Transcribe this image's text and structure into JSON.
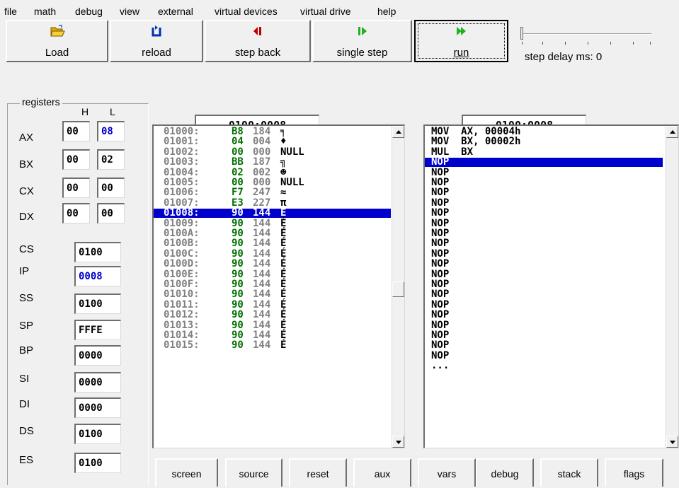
{
  "menu": [
    "file",
    "math",
    "debug",
    "view",
    "external",
    "virtual devices",
    "virtual drive",
    "help"
  ],
  "toolbar": {
    "load": "Load",
    "reload": "reload",
    "step_back": "step back",
    "single_step": "single step",
    "run": "run",
    "step_delay": "step delay ms: 0",
    "step_delay_slider_position": 0,
    "colors": {
      "load": "#e0a800",
      "reload": "#0030b0",
      "step_back": "#c00000",
      "single_step": "#20b020",
      "run": "#20b020"
    }
  },
  "registers": {
    "title": "registers",
    "col_h": "H",
    "col_l": "L",
    "split": [
      {
        "name": "AX",
        "h": "00",
        "l": "08",
        "l_changed": true
      },
      {
        "name": "BX",
        "h": "00",
        "l": "02"
      },
      {
        "name": "CX",
        "h": "00",
        "l": "00"
      },
      {
        "name": "DX",
        "h": "00",
        "l": "00"
      }
    ],
    "full": [
      {
        "name": "CS",
        "value": "0100"
      },
      {
        "name": "IP",
        "value": "0008",
        "changed": true
      },
      {
        "name": "SS",
        "value": "0100"
      },
      {
        "name": "SP",
        "value": "FFFE"
      },
      {
        "name": "BP",
        "value": "0000"
      },
      {
        "name": "SI",
        "value": "0000"
      },
      {
        "name": "DI",
        "value": "0000"
      },
      {
        "name": "DS",
        "value": "0100"
      },
      {
        "name": "ES",
        "value": "0100"
      }
    ]
  },
  "memory": {
    "address": "0100:0008",
    "rows": [
      {
        "addr": "01000:",
        "hex": "B8",
        "dec": "184",
        "chr": "╕"
      },
      {
        "addr": "01001:",
        "hex": "04",
        "dec": "004",
        "chr": "♦"
      },
      {
        "addr": "01002:",
        "hex": "00",
        "dec": "000",
        "chr": "NULL"
      },
      {
        "addr": "01003:",
        "hex": "BB",
        "dec": "187",
        "chr": "╗"
      },
      {
        "addr": "01004:",
        "hex": "02",
        "dec": "002",
        "chr": "☻"
      },
      {
        "addr": "01005:",
        "hex": "00",
        "dec": "000",
        "chr": "NULL"
      },
      {
        "addr": "01006:",
        "hex": "F7",
        "dec": "247",
        "chr": "≈"
      },
      {
        "addr": "01007:",
        "hex": "E3",
        "dec": "227",
        "chr": "π"
      },
      {
        "addr": "01008:",
        "hex": "90",
        "dec": "144",
        "chr": "É",
        "selected": true
      },
      {
        "addr": "01009:",
        "hex": "90",
        "dec": "144",
        "chr": "É"
      },
      {
        "addr": "0100A:",
        "hex": "90",
        "dec": "144",
        "chr": "É"
      },
      {
        "addr": "0100B:",
        "hex": "90",
        "dec": "144",
        "chr": "É"
      },
      {
        "addr": "0100C:",
        "hex": "90",
        "dec": "144",
        "chr": "É"
      },
      {
        "addr": "0100D:",
        "hex": "90",
        "dec": "144",
        "chr": "É"
      },
      {
        "addr": "0100E:",
        "hex": "90",
        "dec": "144",
        "chr": "É"
      },
      {
        "addr": "0100F:",
        "hex": "90",
        "dec": "144",
        "chr": "É"
      },
      {
        "addr": "01010:",
        "hex": "90",
        "dec": "144",
        "chr": "É"
      },
      {
        "addr": "01011:",
        "hex": "90",
        "dec": "144",
        "chr": "É"
      },
      {
        "addr": "01012:",
        "hex": "90",
        "dec": "144",
        "chr": "É"
      },
      {
        "addr": "01013:",
        "hex": "90",
        "dec": "144",
        "chr": "É"
      },
      {
        "addr": "01014:",
        "hex": "90",
        "dec": "144",
        "chr": "É"
      },
      {
        "addr": "01015:",
        "hex": "90",
        "dec": "144",
        "chr": "É"
      }
    ]
  },
  "disassembly": {
    "address": "0100:0008",
    "rows": [
      {
        "text": "MOV  AX, 00004h"
      },
      {
        "text": "MOV  BX, 00002h"
      },
      {
        "text": "MUL  BX"
      },
      {
        "text": "NOP",
        "selected": true
      },
      {
        "text": "NOP"
      },
      {
        "text": "NOP"
      },
      {
        "text": "NOP"
      },
      {
        "text": "NOP"
      },
      {
        "text": "NOP"
      },
      {
        "text": "NOP"
      },
      {
        "text": "NOP"
      },
      {
        "text": "NOP"
      },
      {
        "text": "NOP"
      },
      {
        "text": "NOP"
      },
      {
        "text": "NOP"
      },
      {
        "text": "NOP"
      },
      {
        "text": "NOP"
      },
      {
        "text": "NOP"
      },
      {
        "text": "NOP"
      },
      {
        "text": "NOP"
      },
      {
        "text": "NOP"
      },
      {
        "text": "NOP"
      },
      {
        "text": "NOP"
      },
      {
        "text": "..."
      }
    ]
  },
  "bottom_buttons": [
    "screen",
    "source",
    "reset",
    "aux",
    "vars",
    "debug",
    "stack",
    "flags"
  ]
}
